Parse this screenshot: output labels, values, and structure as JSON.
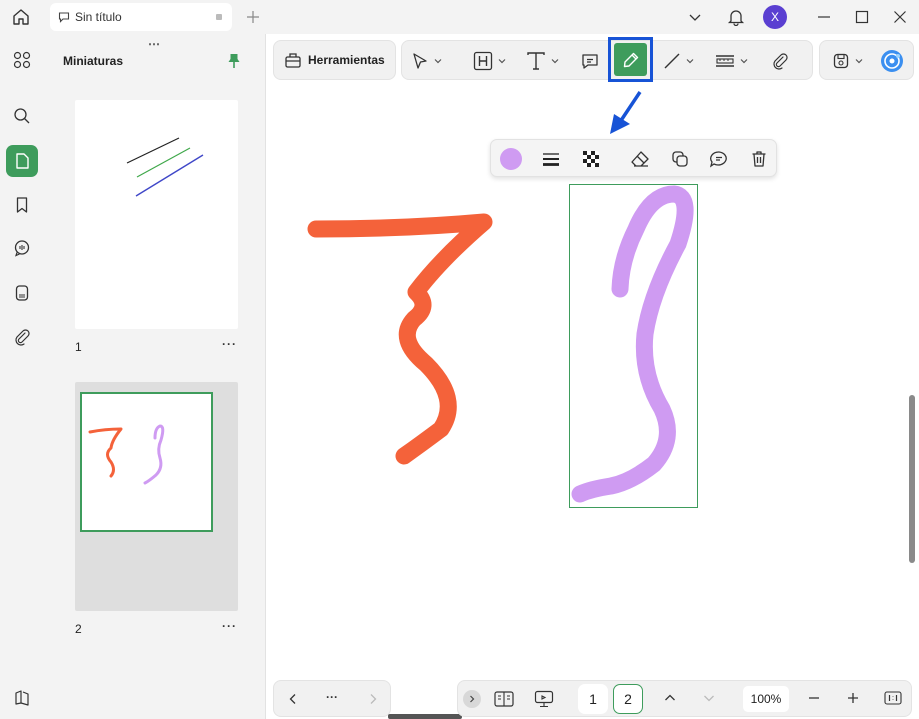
{
  "tab": {
    "title": "Sin título"
  },
  "user": {
    "avatar_letter": "X",
    "avatar_color": "#5a3fd1"
  },
  "panel": {
    "title": "Miniaturas",
    "pages": [
      {
        "number": "1",
        "more": "···"
      },
      {
        "number": "2",
        "more": "···"
      }
    ]
  },
  "toolbar": {
    "tools_label": "Herramientas",
    "active_tool": "pen",
    "accent_color": "#3e9c5c",
    "highlight_color": "#1753d6"
  },
  "pen_toolbar": {
    "pen_color": "#cf9bf2"
  },
  "footer": {
    "nav_more": "···",
    "pages": [
      "1",
      "2"
    ],
    "current_page": "2",
    "zoom": "100%"
  },
  "icons": {
    "home": "home-icon",
    "tab": "chat-bubble-icon",
    "new_tab": "plus-icon",
    "apps": "apps-icon",
    "search": "search-icon",
    "page": "page-icon",
    "bookmark": "bookmark-icon",
    "comments": "comments-icon",
    "stamp": "stamp-icon",
    "attachment": "paperclip-icon",
    "pin": "pin-icon",
    "book": "book-icon"
  },
  "annotations": {
    "red_stroke_color": "#f4623a",
    "purple_stroke_color": "#cf9bf2"
  }
}
